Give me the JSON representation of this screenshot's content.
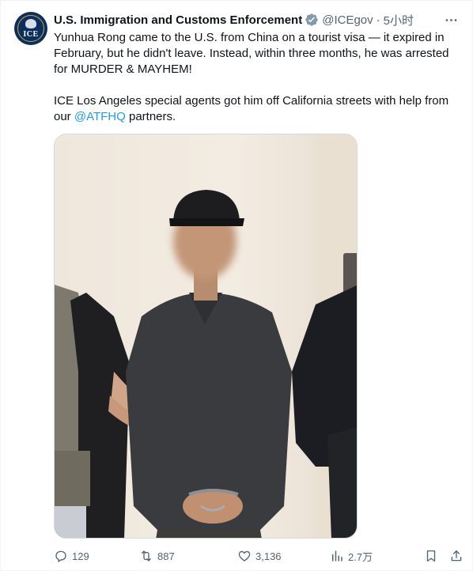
{
  "author": {
    "name": "U.S. Immigration and Customs Enforcement",
    "handle": "@ICEgov",
    "separator": "·",
    "time": "5小时",
    "avatar_text": "ICE",
    "verified_icon": "verified-badge-icon",
    "verified_color": "#829aab"
  },
  "tweet": {
    "line1": "Yunhua Rong came to the U.S. from China on a tourist visa — it expired in February, but he didn't leave. Instead, within three months, he was arrested for MURDER & MAYHEM!",
    "line2_before": "ICE Los Angeles special agents got him off California streets with help from our ",
    "mention": "@ATFHQ",
    "line2_after": " partners."
  },
  "media": {
    "kind": "photo",
    "subject": "man in cap and grey polo with handcuffs, flanked by two agents"
  },
  "actions": {
    "replies": "129",
    "retweets": "887",
    "likes": "3,136",
    "views": "2.7万"
  },
  "icons": {
    "reply": "reply-icon",
    "retweet": "retweet-icon",
    "like": "heart-icon",
    "views": "views-icon",
    "bookmark": "bookmark-icon",
    "share": "share-icon",
    "more": "more-icon"
  },
  "colors": {
    "text": "#0f1419",
    "secondary": "#536471",
    "link": "#1d9bf0"
  }
}
